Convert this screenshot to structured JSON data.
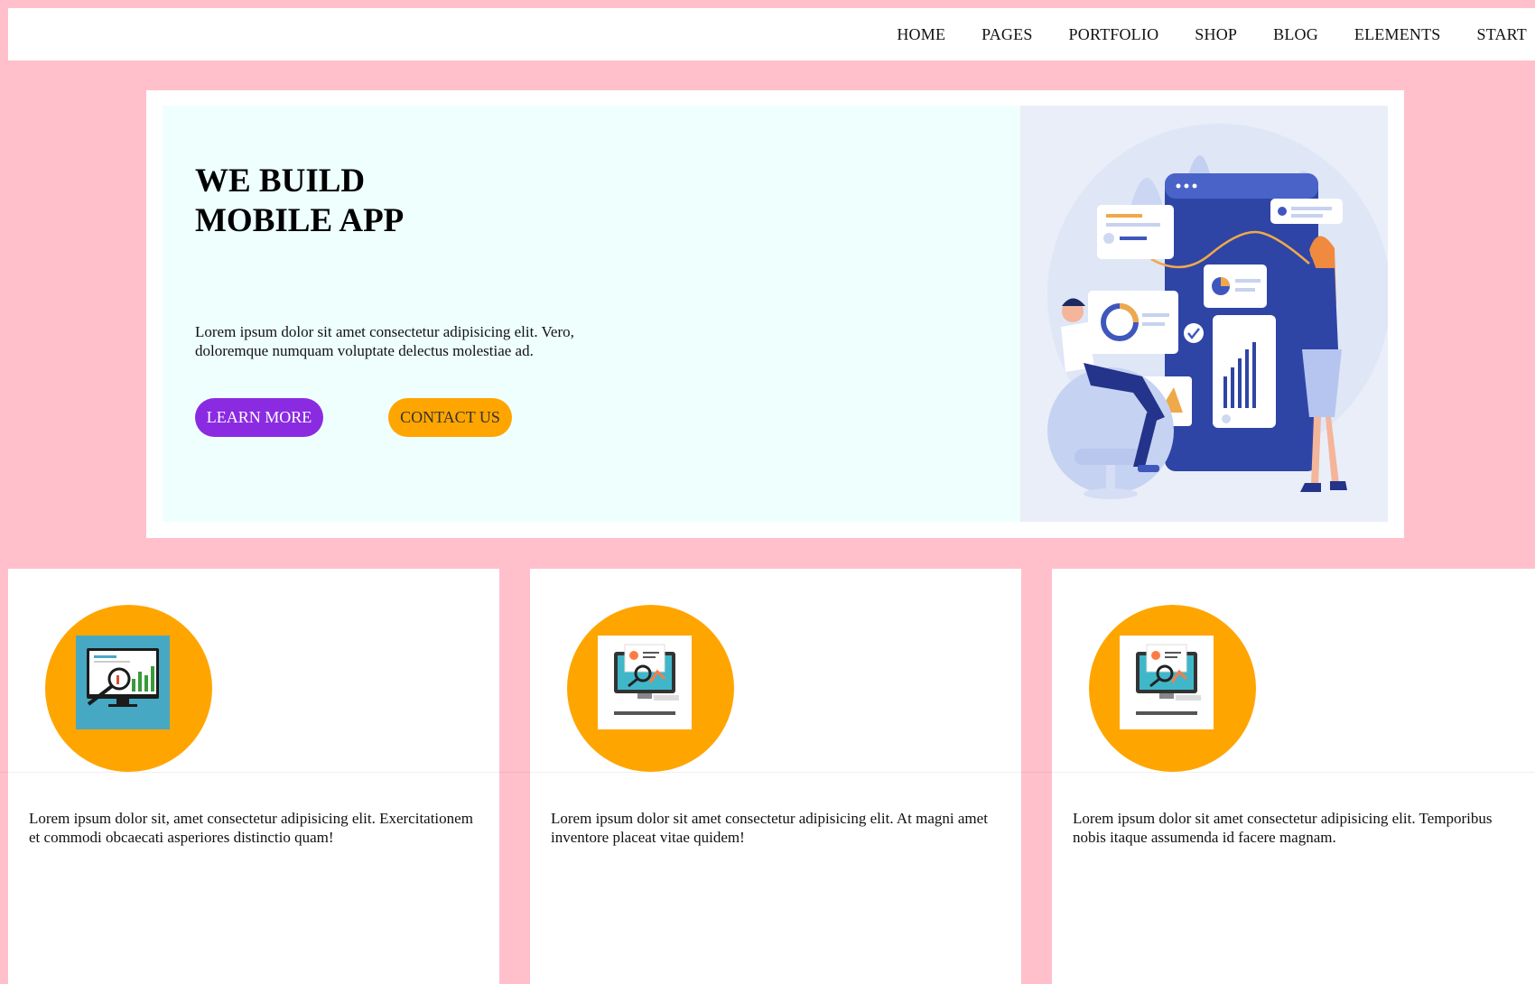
{
  "nav": {
    "items": [
      "HOME",
      "PAGES",
      "PORTFOLIO",
      "SHOP",
      "BLOG",
      "ELEMENTS",
      "START"
    ]
  },
  "hero": {
    "title_line1": "WE BUILD",
    "title_line2": "MOBILE APP",
    "text": "Lorem ipsum dolor sit amet consectetur adipisicing elit. Vero, doloremque numquam voluptate delectus molestiae ad.",
    "learn_more": "LEARN MORE",
    "contact_us": "CONTACT US",
    "illustration": "team-analytics-illustration"
  },
  "cards": [
    {
      "icon": "analytics-icon",
      "icon_label": "ANALYTICS",
      "text": "Lorem ipsum dolor sit, amet consectetur adipisicing elit. Exercitationem et commodi obcaecati asperiores distinctio quam!"
    },
    {
      "icon": "market-analysis-icon",
      "icon_label": "MARKET ANALYSIS",
      "text": "Lorem ipsum dolor sit amet consectetur adipisicing elit. At magni amet inventore placeat vitae quidem!"
    },
    {
      "icon": "market-analysis-icon",
      "icon_label": "MARKET ANALYSIS",
      "text": "Lorem ipsum dolor sit amet consectetur adipisicing elit. Temporibus nobis itaque assumenda id facere magnam."
    }
  ],
  "colors": {
    "page_bg": "#ffc0cb",
    "hero_bg": "#eefffe",
    "learn_more_bg": "#8a2be2",
    "contact_us_bg": "#ffa500",
    "icon_circle": "#ffa500"
  }
}
